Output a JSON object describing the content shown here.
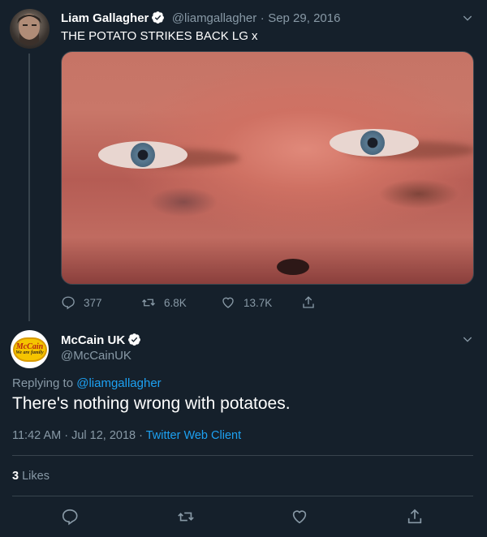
{
  "tweet1": {
    "author_name": "Liam Gallagher",
    "handle": "@liamgallagher",
    "separator": "·",
    "date": "Sep 29, 2016",
    "text": "THE POTATO STRIKES BACK LG x",
    "stats": {
      "replies": "377",
      "retweets": "6.8K",
      "likes": "13.7K"
    }
  },
  "tweet2": {
    "author_name": "McCain UK",
    "handle": "@McCainUK",
    "avatar_logo": {
      "brand": "McCain",
      "tagline": "We are family"
    },
    "replying_prefix": "Replying to ",
    "replying_to": "@liamgallagher",
    "text": "There's nothing wrong with potatoes.",
    "timestamp": "11:42 AM · Jul 12, 2018 · ",
    "client": "Twitter Web Client",
    "likes_count": "3",
    "likes_label": " Likes"
  },
  "colors": {
    "background": "#15202b",
    "accent": "#1da1f2",
    "muted": "#8899a6",
    "divider": "#38444d"
  },
  "icons": [
    "verified-badge-icon",
    "chevron-down-icon",
    "reply-icon",
    "retweet-icon",
    "like-icon",
    "share-icon"
  ]
}
